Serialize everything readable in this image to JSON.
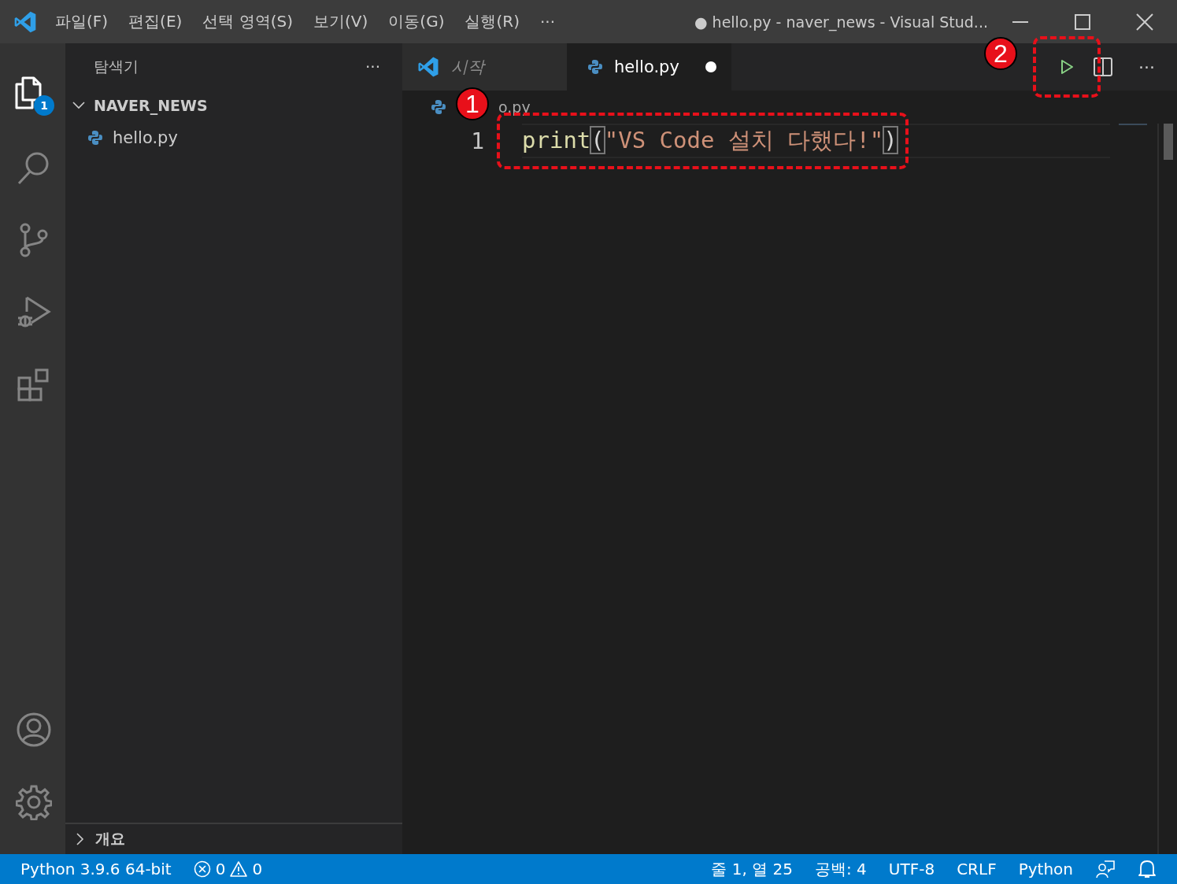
{
  "title_bar": {
    "menu": [
      "파일(F)",
      "편집(E)",
      "선택 영역(S)",
      "보기(V)",
      "이동(G)",
      "실행(R)"
    ],
    "more": "···",
    "title": "● hello.py - naver_news - Visual Stud..."
  },
  "activity_bar": {
    "items": [
      {
        "kind": "explorer",
        "selected": true,
        "badge": "1"
      },
      {
        "kind": "search",
        "selected": false
      },
      {
        "kind": "source-control",
        "selected": false
      },
      {
        "kind": "run-debug",
        "selected": false
      },
      {
        "kind": "extensions",
        "selected": false
      }
    ],
    "bottom": [
      {
        "kind": "account"
      },
      {
        "kind": "settings"
      }
    ]
  },
  "sidebar": {
    "title": "탐색기",
    "more": "···",
    "folder": {
      "name": "NAVER_NEWS",
      "expanded": true,
      "children": [
        {
          "name": "hello.py"
        }
      ]
    },
    "outline": {
      "label": "개요",
      "expanded": false
    }
  },
  "tabs": [
    {
      "label": "시작",
      "kind": "welcome",
      "selected": false,
      "dirty": false
    },
    {
      "label": "hello.py",
      "kind": "python",
      "selected": true,
      "dirty": true
    }
  ],
  "editor_actions": {
    "more": "···"
  },
  "breadcrumb": "o.py",
  "editor": {
    "lines": [
      {
        "number": "1",
        "tokens": [
          {
            "kind": "function",
            "text": "print"
          },
          {
            "kind": "bracket",
            "text": "("
          },
          {
            "kind": "string",
            "text": "\"VS Code 설치 다했다!\""
          },
          {
            "kind": "bracket",
            "text": ")"
          }
        ]
      }
    ]
  },
  "annotations": [
    {
      "label": "1"
    },
    {
      "label": "2"
    }
  ],
  "status_bar": {
    "interpreter": "Python 3.9.6 64-bit",
    "errors": "0",
    "warnings": "0",
    "right": [
      "줄 1, 열 25",
      "공백: 4",
      "UTF-8",
      "CRLF",
      "Python"
    ]
  }
}
